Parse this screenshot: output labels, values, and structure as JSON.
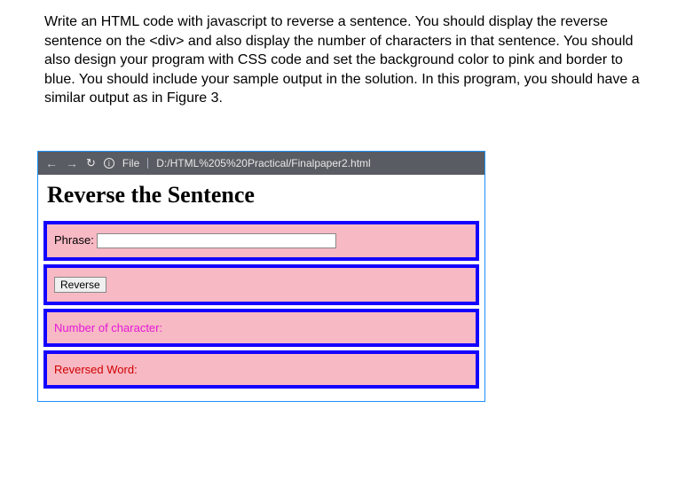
{
  "instructions": "Write an HTML code with javascript to reverse a sentence. You should display the reverse sentence on the <div> and also display the number of characters in that sentence. You should also design your program with CSS code and set the background color to pink and border to blue. You should include your sample output in the solution. In this program, you should have a similar output as in Figure 3.",
  "chrome": {
    "back_symbol": "←",
    "forward_symbol": "→",
    "reload_symbol": "↻",
    "info_symbol": "i",
    "file_label": "File",
    "url": "D:/HTML%205%20Practical/Finalpaper2.html"
  },
  "page": {
    "title": "Reverse the Sentence",
    "phrase_label": "Phrase:",
    "phrase_value": "",
    "reverse_button": "Reverse",
    "char_count_label": "Number of character:",
    "reversed_label": "Reversed Word:"
  }
}
